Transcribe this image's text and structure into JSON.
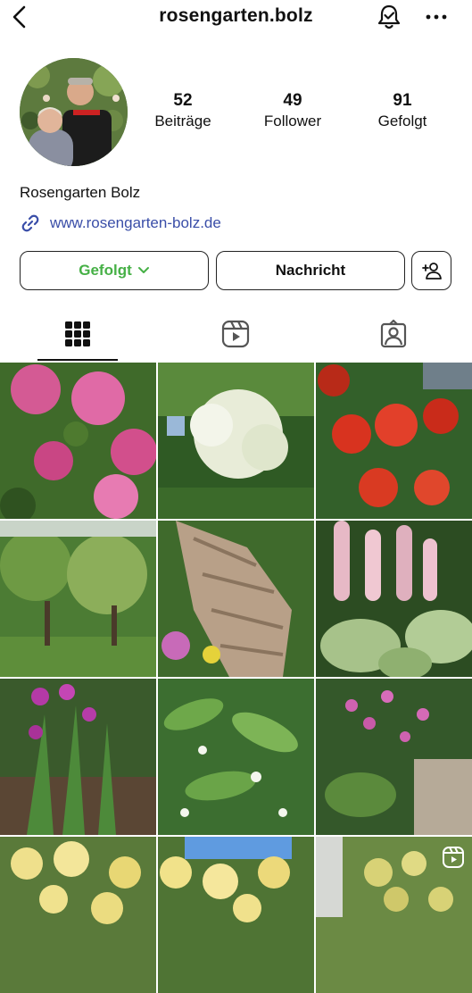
{
  "header": {
    "username": "rosengarten.bolz",
    "icons": [
      "chevron-left-icon",
      "bell-check-icon",
      "more-horizontal-icon"
    ]
  },
  "profile": {
    "stats": [
      {
        "value": "52",
        "label": "Beiträge"
      },
      {
        "value": "49",
        "label": "Follower"
      },
      {
        "value": "91",
        "label": "Gefolgt"
      }
    ],
    "display_name": "Rosengarten Bolz",
    "website": "www.rosengarten-bolz.de"
  },
  "actions": {
    "follow_label": "Gefolgt",
    "message_label": "Nachricht"
  },
  "tabs": {
    "items": [
      {
        "name": "posts",
        "icon": "grid-icon",
        "selected": true
      },
      {
        "name": "reels",
        "icon": "reels-icon",
        "selected": false
      },
      {
        "name": "tagged",
        "icon": "tagged-person-icon",
        "selected": false
      }
    ]
  },
  "colors": {
    "follow_green": "#46b046",
    "link_blue": "#3a4ea8"
  },
  "posts": [
    {
      "subject": "pink rhododendron",
      "is_reel": false
    },
    {
      "subject": "white flowering shrub",
      "is_reel": false
    },
    {
      "subject": "red rhododendron",
      "is_reel": false
    },
    {
      "subject": "garden trees and lawn",
      "is_reel": false
    },
    {
      "subject": "stone wall with plants",
      "is_reel": false
    },
    {
      "subject": "pink tiarella and brunnera leaves",
      "is_reel": false
    },
    {
      "subject": "purple bletilla orchids",
      "is_reel": false
    },
    {
      "subject": "white wild garlic flowers",
      "is_reel": false
    },
    {
      "subject": "pink bleeding hearts",
      "is_reel": false
    },
    {
      "subject": "yellow roses",
      "is_reel": false
    },
    {
      "subject": "yellow roses and blue sky",
      "is_reel": false
    },
    {
      "subject": "yellow climbing rose",
      "is_reel": true
    }
  ]
}
